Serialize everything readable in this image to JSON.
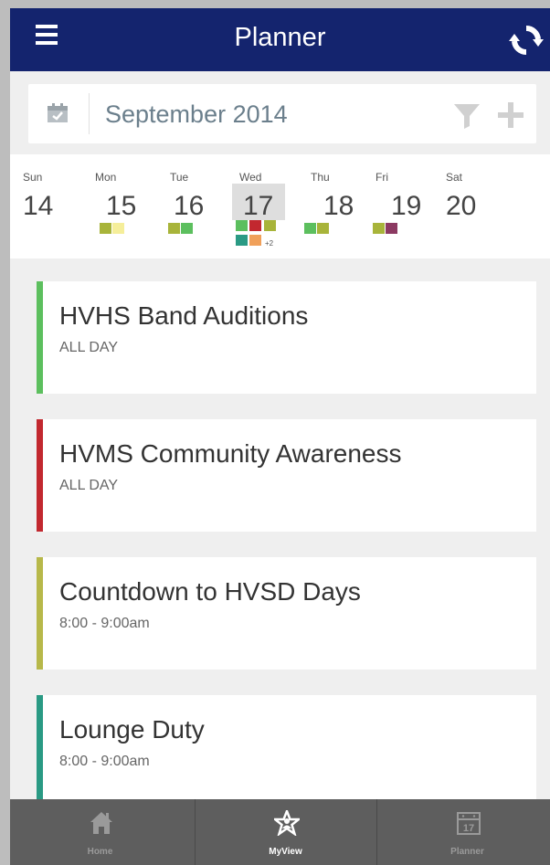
{
  "header": {
    "title": "Planner",
    "menu_icon": "hamburger-menu-icon",
    "refresh_icon": "sync-icon"
  },
  "month_bar": {
    "label": "September 2014",
    "calendar_icon": "calendar-icon",
    "filter_icon": "filter-icon",
    "add_icon": "plus-icon"
  },
  "week": {
    "days": [
      {
        "name": "Sun",
        "num": "14"
      },
      {
        "name": "Mon",
        "num": "15"
      },
      {
        "name": "Tue",
        "num": "16"
      },
      {
        "name": "Wed",
        "num": "17",
        "selected": true
      },
      {
        "name": "Thu",
        "num": "18"
      },
      {
        "name": "Fri",
        "num": "19"
      },
      {
        "name": "Sat",
        "num": "20"
      }
    ],
    "more_label": "+2",
    "colors": {
      "olive": "#a8b43a",
      "yellow": "#f5ee9a",
      "green": "#5cbf5e",
      "red": "#c2282f",
      "teal": "#2a9a84",
      "orange": "#f0a05a",
      "plum": "#8c3a62"
    }
  },
  "events": [
    {
      "title": "HVHS Band Auditions",
      "time": "ALL DAY",
      "color": "#5cbf5e"
    },
    {
      "title": "HVMS Community Awareness",
      "time": "ALL DAY",
      "color": "#c2282f"
    },
    {
      "title": "Countdown to HVSD Days",
      "time": "8:00 - 9:00am",
      "color": "#b7b84a"
    },
    {
      "title": "Lounge Duty",
      "time": "8:00 - 9:00am",
      "color": "#2a9a84"
    }
  ],
  "nav": [
    {
      "label": "Home",
      "icon": "home-icon"
    },
    {
      "label": "MyView",
      "icon": "star-person-icon",
      "active": true
    },
    {
      "label": "Planner",
      "icon": "calendar-17-icon"
    }
  ],
  "nav_planner_icon_text": "17",
  "colors": {
    "header": "#14246e",
    "nav_bg": "#5e5e5e",
    "background": "#efefef"
  }
}
